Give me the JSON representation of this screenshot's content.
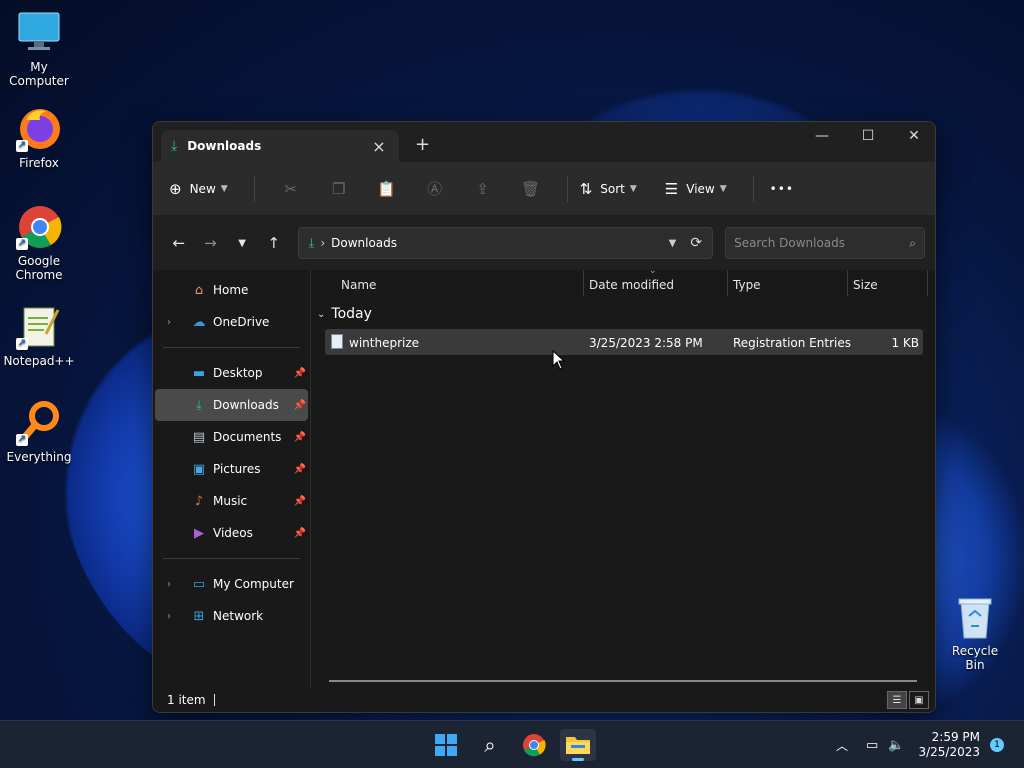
{
  "desktop": {
    "icons": [
      {
        "label": "My Computer",
        "icon": "monitor-icon"
      },
      {
        "label": "Firefox",
        "icon": "firefox-icon"
      },
      {
        "label": "Google Chrome",
        "icon": "chrome-icon"
      },
      {
        "label": "Notepad++",
        "icon": "notepadpp-icon"
      },
      {
        "label": "Everything",
        "icon": "magnifier-icon"
      }
    ],
    "recycle_bin": "Recycle Bin"
  },
  "window": {
    "tab_title": "Downloads",
    "new_tab": "+",
    "controls": {
      "minimize": "—",
      "maximize": "☐",
      "close": "✕"
    }
  },
  "toolbar": {
    "new_label": "New",
    "sort_label": "Sort",
    "view_label": "View",
    "more_label": "•••"
  },
  "address": {
    "crumb": "Downloads",
    "search_placeholder": "Search Downloads"
  },
  "sidebar": {
    "items": [
      {
        "label": "Home",
        "icon": "home-icon"
      },
      {
        "label": "OneDrive",
        "icon": "cloud-icon"
      },
      {
        "label": "Desktop",
        "icon": "desktop-icon"
      },
      {
        "label": "Downloads",
        "icon": "download-icon"
      },
      {
        "label": "Documents",
        "icon": "document-icon"
      },
      {
        "label": "Pictures",
        "icon": "picture-icon"
      },
      {
        "label": "Music",
        "icon": "music-icon"
      },
      {
        "label": "Videos",
        "icon": "video-icon"
      },
      {
        "label": "My Computer",
        "icon": "computer-icon"
      },
      {
        "label": "Network",
        "icon": "network-icon"
      }
    ]
  },
  "filelist": {
    "columns": [
      "Name",
      "Date modified",
      "Type",
      "Size"
    ],
    "group": "Today",
    "rows": [
      {
        "name": "wintheprize",
        "date": "3/25/2023 2:58 PM",
        "type": "Registration Entries",
        "size": "1 KB"
      }
    ]
  },
  "status": {
    "count": "1 item"
  },
  "taskbar": {
    "time": "2:59 PM",
    "date": "3/25/2023",
    "notification_count": "1"
  }
}
